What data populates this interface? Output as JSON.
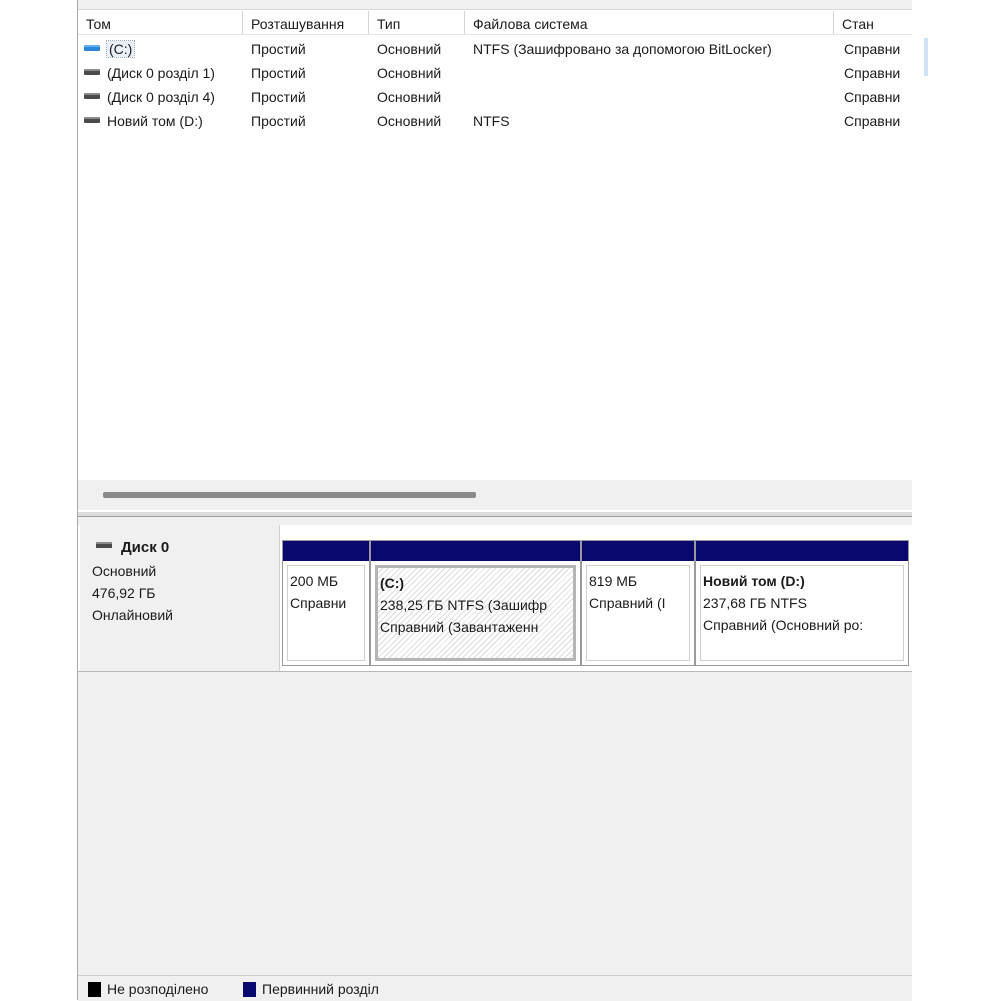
{
  "columns": [
    "Том",
    "Розташування",
    "Тип",
    "Файлова система",
    "Стан"
  ],
  "volumes": [
    {
      "icon": "blue-volume-icon",
      "name": "(C:)",
      "layout": "Простий",
      "type": "Основний",
      "fs": "NTFS (Зашифровано за допомогою BitLocker)",
      "status": "Справни",
      "selected": true
    },
    {
      "icon": "gray-volume-icon",
      "name": "(Диск 0 розділ 1)",
      "layout": "Простий",
      "type": "Основний",
      "fs": "",
      "status": "Справни"
    },
    {
      "icon": "gray-volume-icon",
      "name": "(Диск 0 розділ 4)",
      "layout": "Простий",
      "type": "Основний",
      "fs": "",
      "status": "Справни"
    },
    {
      "icon": "gray-volume-icon",
      "name": "Новий том (D:)",
      "layout": "Простий",
      "type": "Основний",
      "fs": "NTFS",
      "status": "Справни"
    }
  ],
  "disk": {
    "name": "Диск 0",
    "type": "Основний",
    "size": "476,92 ГБ",
    "state": "Онлайновий",
    "partitions": [
      {
        "title": "",
        "size": "200 МБ",
        "status": "Справни"
      },
      {
        "title": "(C:)",
        "size": "238,25 ГБ NTFS (Зашифр",
        "status": "Справний (Завантаженн",
        "selected": true
      },
      {
        "title": "",
        "size": "819 МБ",
        "status": "Справний (I"
      },
      {
        "title": "Новий том  (D:)",
        "size": "237,68 ГБ NTFS",
        "status": "Справний (Основний ро:"
      }
    ]
  },
  "legend": {
    "unallocated": "Не розподілено",
    "primary": "Первинний розділ",
    "unallocated_color": "#000000",
    "primary_color": "#08086e"
  }
}
